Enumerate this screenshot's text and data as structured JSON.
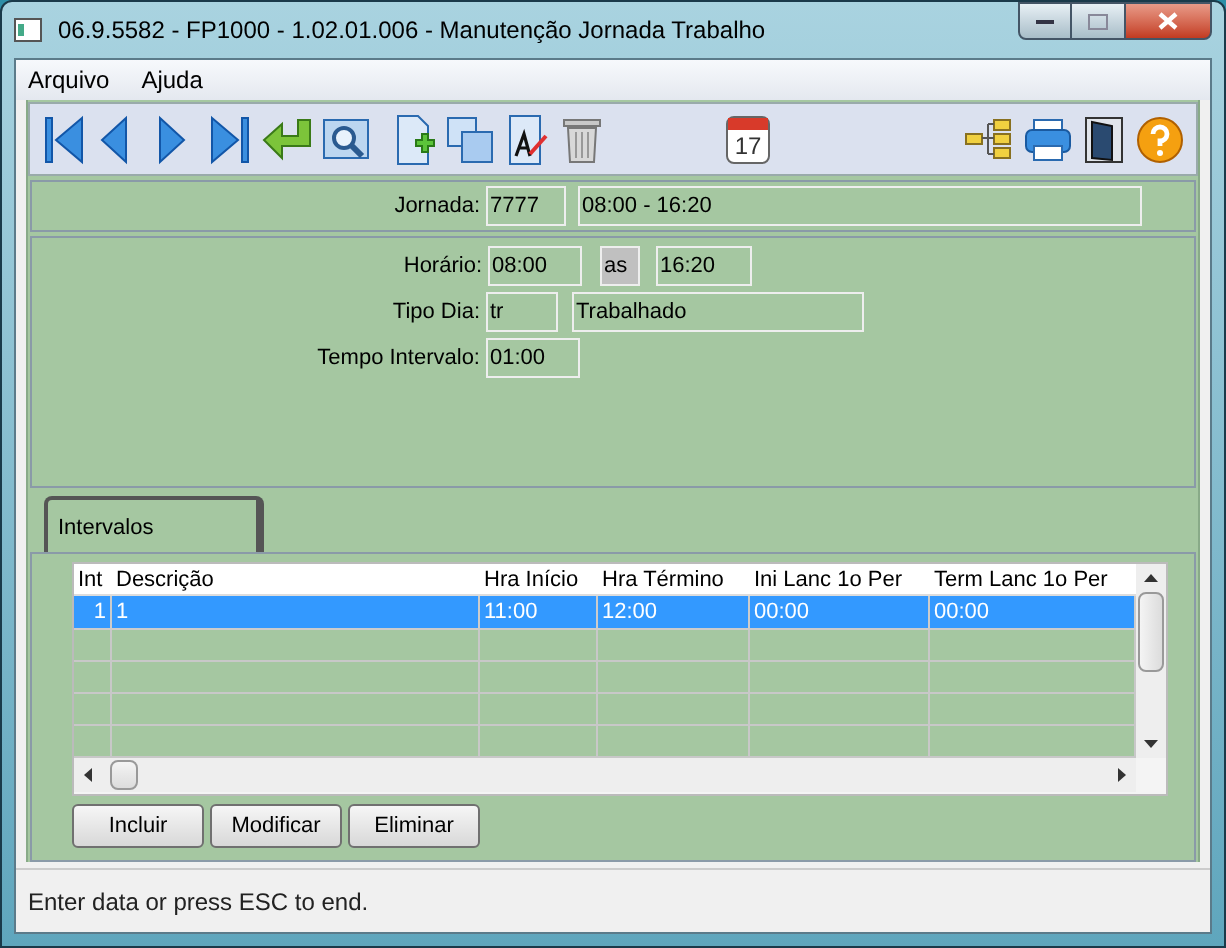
{
  "window": {
    "title": "06.9.5582 - FP1000 - 1.02.01.006 - Manutenção Jornada Trabalho"
  },
  "menu": [
    "Arquivo",
    "Ajuda"
  ],
  "toolbar": {
    "calendar_day": "17"
  },
  "jornada": {
    "label": "Jornada:",
    "code": "7777",
    "description": "08:00 - 16:20"
  },
  "horario": {
    "label": "Horário:",
    "start": "08:00",
    "separator": "as",
    "end": "16:20"
  },
  "tipo_dia": {
    "label": "Tipo Dia:",
    "code": "tr",
    "description": "Trabalhado"
  },
  "tempo_intervalo": {
    "label": "Tempo Intervalo:",
    "value": "01:00"
  },
  "tabs": [
    {
      "label": "Intervalos",
      "selected": true
    }
  ],
  "table": {
    "columns": [
      "Int",
      "Descrição",
      "Hra Início",
      "Hra Término",
      "Ini Lanc 1o Per",
      "Term Lanc 1o Per"
    ],
    "rows": [
      {
        "cells": [
          "1",
          "1",
          "11:00",
          "12:00",
          "00:00",
          "00:00"
        ],
        "selected": true
      }
    ]
  },
  "buttons": [
    "Incluir",
    "Modificar",
    "Eliminar"
  ],
  "status_bar": "Enter data or press ESC to end."
}
